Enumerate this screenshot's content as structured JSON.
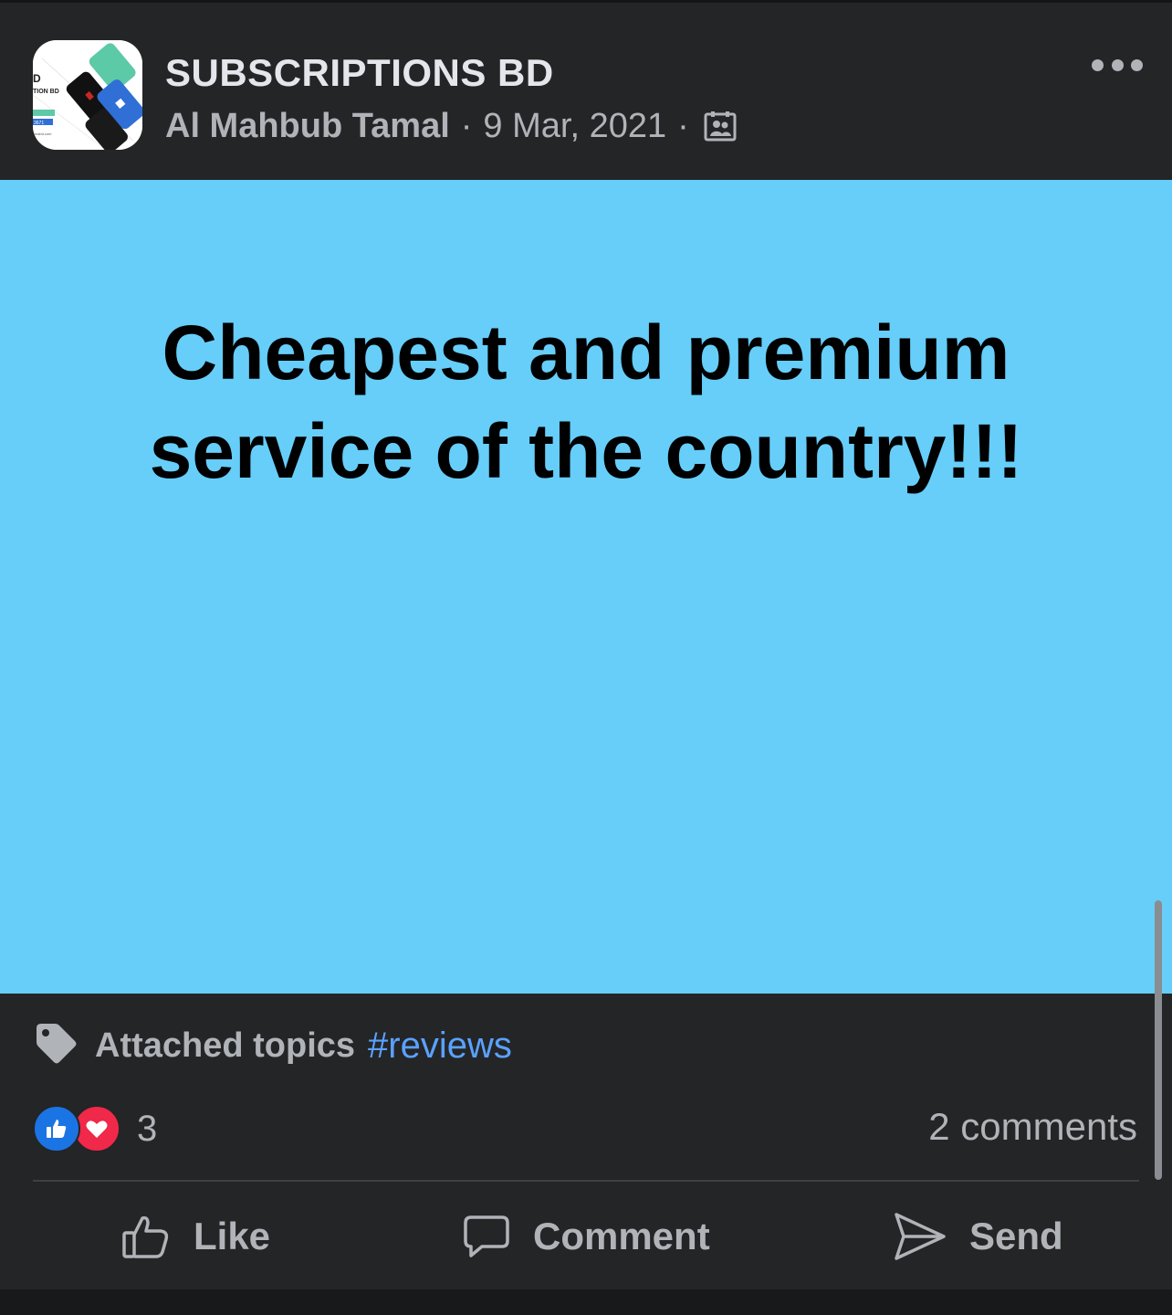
{
  "post": {
    "page_name": "SUBSCRIPTIONS BD",
    "author": "Al Mahbub Tamal",
    "separator": "·",
    "date": "9 Mar, 2021",
    "audience_icon": "group-audience-icon",
    "more_icon": "more-options-icon",
    "avatar_icon": "page-logo-avatar",
    "content_text": "Cheapest and premium service of the country!!!",
    "background_color": "#66cef9"
  },
  "topics": {
    "label": "Attached topics",
    "tag": "#reviews",
    "icon": "tag-icon"
  },
  "reactions": {
    "count": "3",
    "types": [
      "like",
      "love"
    ]
  },
  "comments": {
    "label": "2 comments"
  },
  "actions": {
    "like_label": "Like",
    "comment_label": "Comment",
    "send_label": "Send"
  },
  "colors": {
    "card_background": "#242526",
    "text_primary": "#e4e6eb",
    "text_secondary": "#b0b3b8",
    "link": "#5aa1ff",
    "like": "#1b74e4",
    "love": "#f0284a"
  }
}
